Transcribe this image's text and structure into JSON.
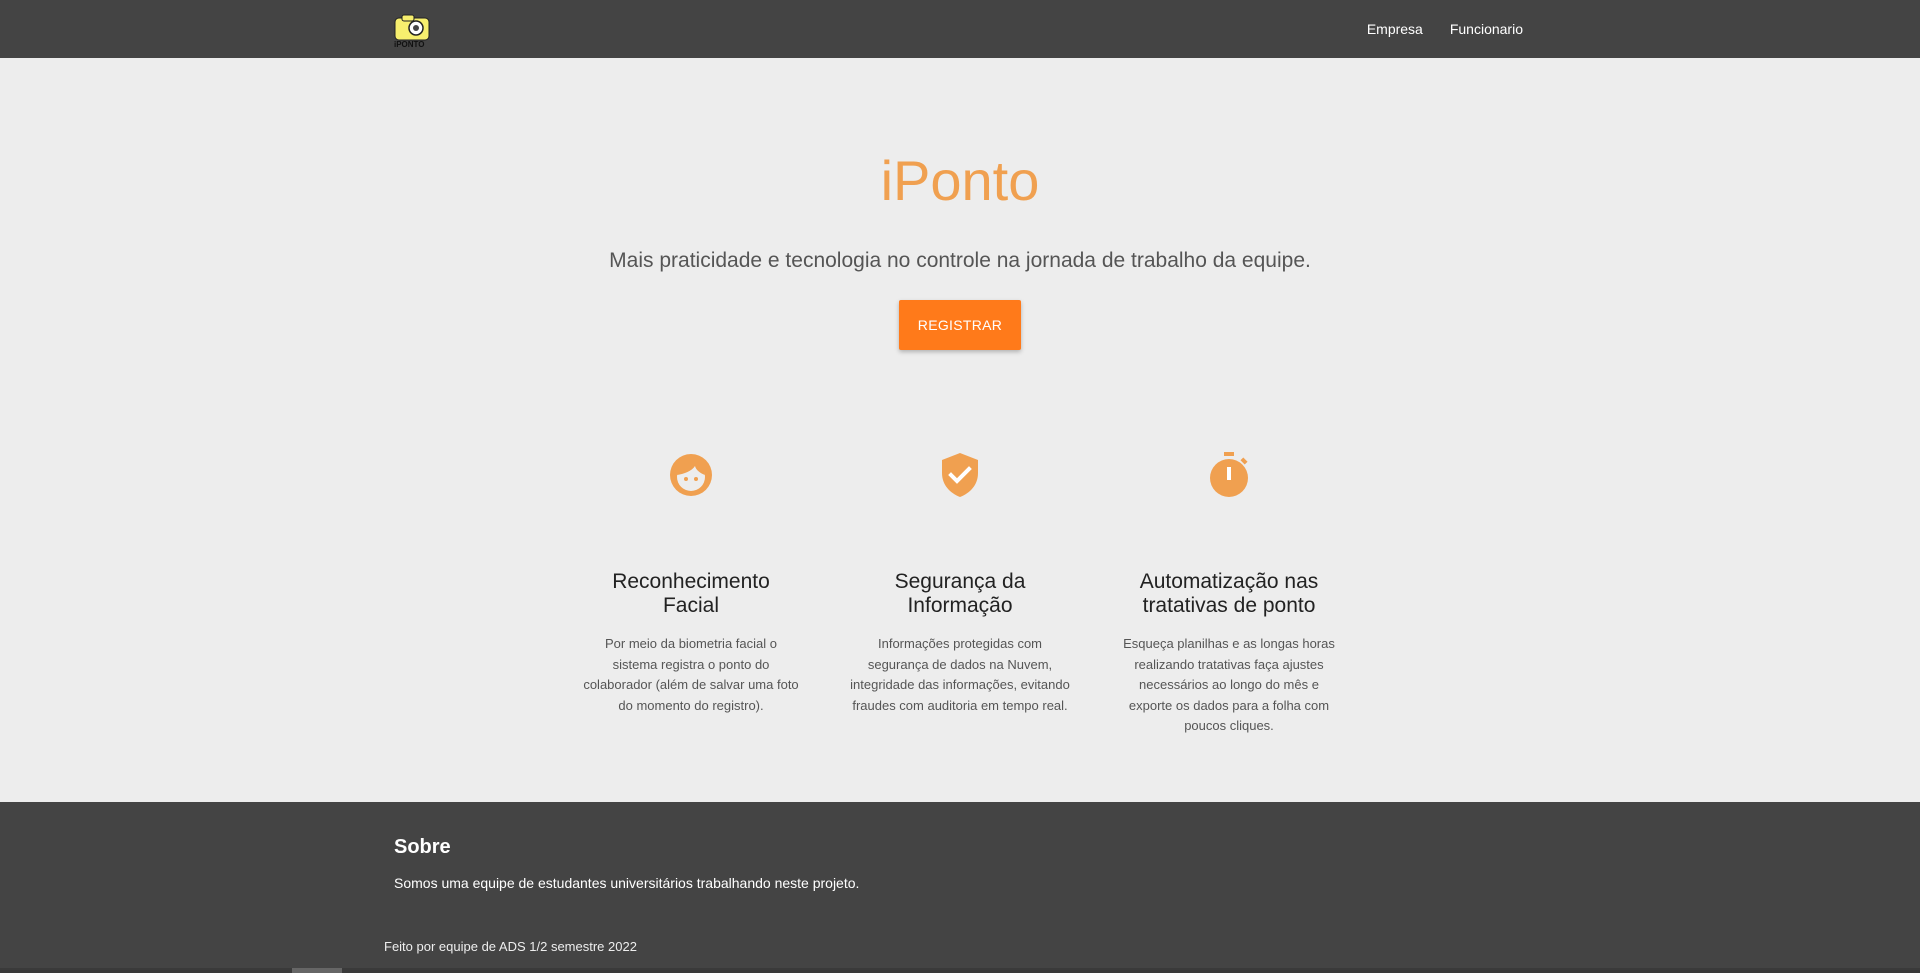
{
  "nav": {
    "logo_icon": "iponto-logo",
    "links": [
      "Empresa",
      "Funcionario"
    ]
  },
  "hero": {
    "title": "iPonto",
    "subtitle": "Mais praticidade e tecnologia no controle na jornada de trabalho da equipe.",
    "cta": "REGISTRAR"
  },
  "features": [
    {
      "icon": "face-icon",
      "title_line1": "Reconhecimento",
      "title_line2": "Facial",
      "text": "Por meio da biometria facial o sistema registra o ponto do colaborador (além de salvar uma foto do momento do registro)."
    },
    {
      "icon": "shield-check-icon",
      "title_line1": "Segurança da",
      "title_line2": "Informação",
      "text": "Informações protegidas com segurança de dados na Nuvem, integridade das informações, evitando fraudes com auditoria em tempo real."
    },
    {
      "icon": "stopwatch-icon",
      "title_line1": "Automatização nas",
      "title_line2": "tratativas de ponto",
      "text": "Esqueça planilhas e as longas horas realizando tratativas faça ajustes necessários ao longo do mês e exporte os dados para a folha com poucos cliques."
    }
  ],
  "footer": {
    "title": "Sobre",
    "text": "Somos uma equipe de estudantes universitários trabalhando neste projeto.",
    "credit": "Feito por equipe de ADS 1/2 semestre 2022"
  },
  "colors": {
    "accent": "#f0a050",
    "button": "#ff7a1a",
    "dark": "#444444",
    "background": "#ededed"
  }
}
